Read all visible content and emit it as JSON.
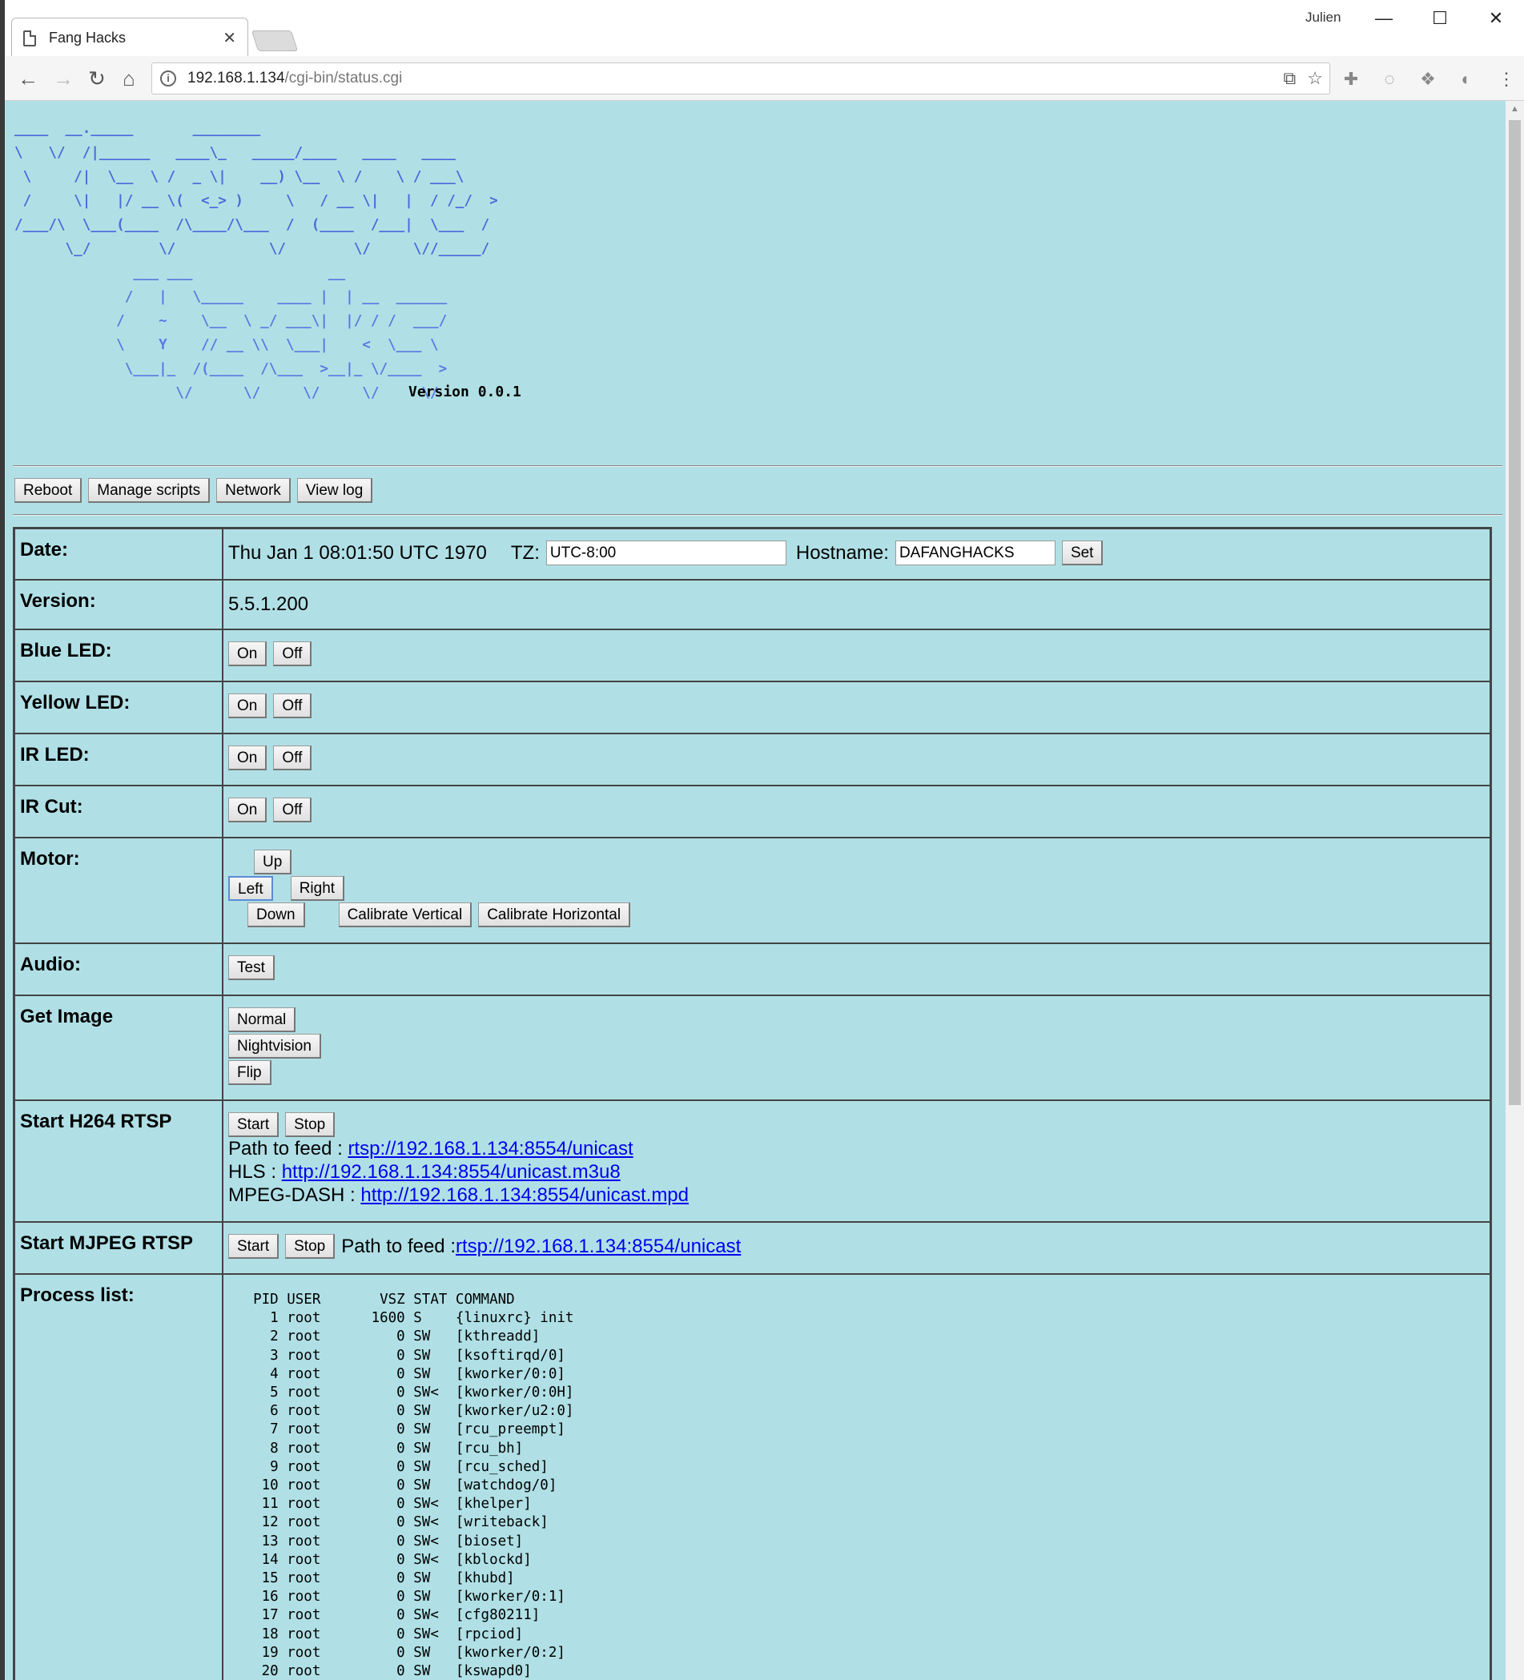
{
  "browser": {
    "tab_title": "Fang Hacks",
    "profile_name": "Julien",
    "url_host": "192.168.1.134",
    "url_path": "/cgi-bin/status.cgi"
  },
  "logo": {
    "lines": [
      "____  __._____       ________",
      "\\   \\/  /|______   ____\\_   _____/____   ____   ____",
      " \\     /|  \\__  \\ /  _ \\|    __) \\__  \\ /    \\ / ___\\",
      " /     \\|   |/ __ \\(  <_> )     \\   / __ \\|   |  / /_/  >",
      "/___/\\  \\___(____  /\\____/\\___  /  (____  /___|  \\___  /",
      "      \\_/        \\/           \\/        \\/     \\//_____/",
      "              ___ ___                __",
      "             /   |   \\_____    ____ |  | __  ______",
      "            /    ~    \\__  \\ _/ ___\\|  |/ / /  ___/",
      "            \\    Y    // __ \\\\  \\___|    <  \\___ \\",
      "             \\___|_  /(____  /\\___  >__|_ \\/____  >",
      "                   \\/      \\/     \\/     \\/     \\/"
    ],
    "version": "Version 0.0.1"
  },
  "nav": {
    "reboot": "Reboot",
    "manage_scripts": "Manage scripts",
    "network": "Network",
    "view_log": "View log"
  },
  "status": {
    "date_label": "Date:",
    "date_value": "Thu Jan 1 08:01:50 UTC 1970",
    "tz_label": "TZ:",
    "tz_value": "UTC-8:00",
    "hostname_label": "Hostname:",
    "hostname_value": "DAFANGHACKS",
    "set_label": "Set",
    "version_label": "Version:",
    "version_value": "5.5.1.200",
    "on": "On",
    "off": "Off",
    "blue_led_label": "Blue LED:",
    "yellow_led_label": "Yellow LED:",
    "ir_led_label": "IR LED:",
    "ir_cut_label": "IR Cut:",
    "motor_label": "Motor:",
    "motor_up": "Up",
    "motor_left": "Left",
    "motor_right": "Right",
    "motor_down": "Down",
    "calibrate_vertical": "Calibrate Vertical",
    "calibrate_horizontal": "Calibrate Horizontal",
    "audio_label": "Audio:",
    "audio_test": "Test",
    "get_image_label": "Get Image",
    "image_normal": "Normal",
    "image_nightvision": "Nightvision",
    "image_flip": "Flip",
    "h264_label": "Start H264 RTSP",
    "start": "Start",
    "stop": "Stop",
    "path_to_feed": "Path to feed : ",
    "h264_rtsp_url": "rtsp://192.168.1.134:8554/unicast",
    "hls_label": "HLS : ",
    "hls_url": "http://192.168.1.134:8554/unicast.m3u8",
    "dash_label": "MPEG-DASH : ",
    "dash_url": "http://192.168.1.134:8554/unicast.mpd",
    "mjpeg_label": "Start MJPEG RTSP",
    "mjpeg_rtsp_url": "rtsp://192.168.1.134:8554/unicast",
    "process_list_label": "Process list:"
  },
  "process_list": {
    "header": "  PID USER       VSZ STAT COMMAND",
    "rows": [
      "    1 root      1600 S    {linuxrc} init",
      "    2 root         0 SW   [kthreadd]",
      "    3 root         0 SW   [ksoftirqd/0]",
      "    4 root         0 SW   [kworker/0:0]",
      "    5 root         0 SW<  [kworker/0:0H]",
      "    6 root         0 SW   [kworker/u2:0]",
      "    7 root         0 SW   [rcu_preempt]",
      "    8 root         0 SW   [rcu_bh]",
      "    9 root         0 SW   [rcu_sched]",
      "   10 root         0 SW   [watchdog/0]",
      "   11 root         0 SW<  [khelper]",
      "   12 root         0 SW<  [writeback]",
      "   13 root         0 SW<  [bioset]",
      "   14 root         0 SW<  [kblockd]",
      "   15 root         0 SW   [khubd]",
      "   16 root         0 SW   [kworker/0:1]",
      "   17 root         0 SW<  [cfg80211]",
      "   18 root         0 SW<  [rpciod]",
      "   19 root         0 SW   [kworker/0:2]",
      "   20 root         0 SW   [kswapd0]"
    ]
  }
}
